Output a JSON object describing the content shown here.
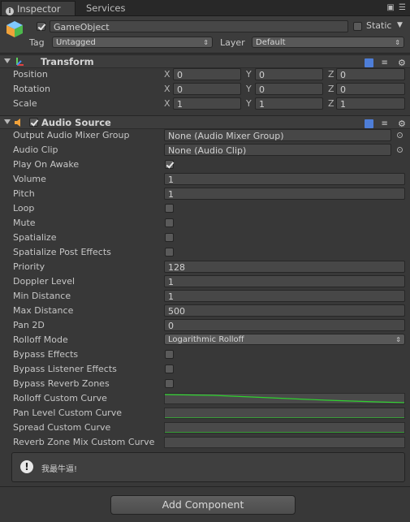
{
  "tabs": {
    "inspector": "Inspector",
    "services": "Services"
  },
  "gameobject": {
    "active": true,
    "name": "GameObject",
    "static_label": "Static",
    "tag_label": "Tag",
    "tag_value": "Untagged",
    "layer_label": "Layer",
    "layer_value": "Default"
  },
  "transform": {
    "title": "Transform",
    "rows": [
      {
        "label": "Position",
        "x": "0",
        "y": "0",
        "z": "0"
      },
      {
        "label": "Rotation",
        "x": "0",
        "y": "0",
        "z": "0"
      },
      {
        "label": "Scale",
        "x": "1",
        "y": "1",
        "z": "1"
      }
    ],
    "axis_x": "X",
    "axis_y": "Y",
    "axis_z": "Z"
  },
  "audio_source": {
    "title": "Audio Source",
    "enabled": true,
    "output_label": "Output Audio Mixer Group",
    "output_value": "None (Audio Mixer Group)",
    "clip_label": "Audio Clip",
    "clip_value": "None (Audio Clip)",
    "play_on_awake_label": "Play On Awake",
    "play_on_awake": true,
    "volume_label": "Volume",
    "volume": "1",
    "pitch_label": "Pitch",
    "pitch": "1",
    "loop_label": "Loop",
    "loop": false,
    "mute_label": "Mute",
    "mute": false,
    "spatialize_label": "Spatialize",
    "spatialize": false,
    "spatialize_post_label": "Spatialize Post Effects",
    "spatialize_post": false,
    "priority_label": "Priority",
    "priority": "128",
    "doppler_label": "Doppler Level",
    "doppler": "1",
    "min_distance_label": "Min Distance",
    "min_distance": "1",
    "max_distance_label": "Max Distance",
    "max_distance": "500",
    "pan_label": "Pan 2D",
    "pan": "0",
    "rolloff_mode_label": "Rolloff Mode",
    "rolloff_mode": "Logarithmic Rolloff",
    "bypass_effects_label": "Bypass Effects",
    "bypass_effects": false,
    "bypass_listener_label": "Bypass Listener Effects",
    "bypass_listener": false,
    "bypass_reverb_label": "Bypass Reverb Zones",
    "bypass_reverb": false,
    "rolloff_curve_label": "Rolloff Custom Curve",
    "pan_curve_label": "Pan Level Custom Curve",
    "spread_curve_label": "Spread Custom Curve",
    "reverb_curve_label": "Reverb Zone Mix Custom Curve",
    "curve_color": "#2fd12f"
  },
  "help": {
    "icon": "!",
    "message": "我最牛逼!"
  },
  "add_component_label": "Add Component"
}
